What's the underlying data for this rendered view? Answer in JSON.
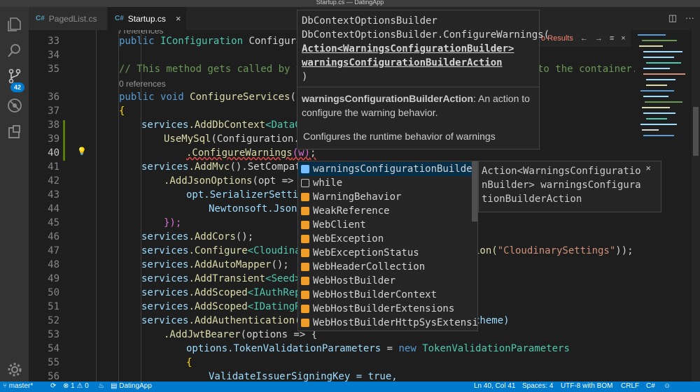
{
  "window": {
    "title": "Startup.cs — DatingApp"
  },
  "activity": {
    "scm_badge": "42"
  },
  "tabs": [
    {
      "icon": "C#",
      "label": "PagedList.cs"
    },
    {
      "icon": "C#",
      "label": "Startup.cs",
      "close": "×"
    }
  ],
  "line_numbers": [
    "33",
    "34",
    "35",
    "36",
    "37",
    "38",
    "39",
    "40",
    "41",
    "42",
    "43",
    "44",
    "45",
    "46",
    "47",
    "48",
    "49",
    "50",
    "51",
    "52",
    "53",
    "54",
    "55",
    "56"
  ],
  "codelens": {
    "refs_top": "/ references",
    "refs_35": "0 references"
  },
  "code": {
    "l33_a": "public ",
    "l33_b": "IConfiguration",
    "l33_c": " Configurati",
    "l35": "// This method gets called by th",
    "l35_tail": "to the container.",
    "l36_a": "public ",
    "l36_b": "void",
    "l36_c": " ConfigureServices",
    "l36_d": "(IS",
    "l37": "{",
    "l38_a": "services",
    "l38_b": ".AddDbContext",
    "l38_c": "<DataCo",
    "l39_a": "UseMySql",
    "l39_b": "(Configuration.G",
    "l40_a": ".ConfigureWarnings",
    "l40_b": "(w)",
    "l40_c": ";",
    "l41_a": "services",
    "l41_b": ".AddMvc",
    "l41_c": "().SetCompati",
    "l42_a": ".AddJsonOptions",
    "l42_b": "(opt => {",
    "l43": "opt.SerializerSettin",
    "l44": "Newtonsoft.Json.",
    "l45": "});",
    "l46_a": "services",
    "l46_b": ".AddCors",
    "l46_c": "();",
    "l47_a": "services",
    "l47_b": ".Configure",
    "l47_c": "<Cloudinar",
    "l47_tail_a": "ion(",
    "l47_tail_b": "\"CloudinarySettings\"",
    "l47_tail_c": "));",
    "l48_a": "services",
    "l48_b": ".AddAutoMapper",
    "l48_c": "();",
    "l49_a": "services",
    "l49_b": ".AddTransient",
    "l49_c": "<Seed>(",
    "l50_a": "services",
    "l50_b": ".AddScoped",
    "l50_c": "<IAuthRepo",
    "l51_a": "services",
    "l51_b": ".AddScoped",
    "l51_c": "<IDatingRe",
    "l52_a": "services",
    "l52_b": ".AddAuthentication",
    "l52_c": "(J",
    "l52_tail": "cheme)",
    "l53_a": ".AddJwtBearer",
    "l53_b": "(options => {",
    "l54_a": "options",
    "l54_b": ".TokenValidationParameters",
    "l54_c": " = ",
    "l54_d": "new",
    "l54_e": " TokenValidationParameters",
    "l55": "{",
    "l56": "ValidateIssuerSigningKey = true,"
  },
  "hover": {
    "type": "DbContextOptionsBuilder",
    "method": "DbContextOptionsBuilder.ConfigureWarnings(",
    "param_type": "Action<WarningsConfigurationBuilder>",
    "param_name": "warningsConfigurationBuilderAction",
    "close_paren": ")",
    "param_doc_name": "warningsConfigurationBuilderAction",
    "param_doc_text": ": An action to configure the warning behavior.",
    "summary": "Configures the runtime behavior of warnings"
  },
  "find_widget": {
    "status": "o Results",
    "prev": "←",
    "next": "→",
    "menu": "≡",
    "close": "×"
  },
  "suggestions": [
    {
      "icon": "variable-icon",
      "label": "warningsConfigurationBuilderA",
      "match": "w"
    },
    {
      "icon": "keyword-icon",
      "label": "while",
      "match": "w"
    },
    {
      "icon": "class-icon",
      "label": "WarningBehavior",
      "match": "W"
    },
    {
      "icon": "class-icon",
      "label": "WeakReference",
      "match": "W"
    },
    {
      "icon": "class-icon",
      "label": "WebClient",
      "match": "W"
    },
    {
      "icon": "class-icon",
      "label": "WebException",
      "match": "W"
    },
    {
      "icon": "class-icon",
      "label": "WebExceptionStatus",
      "match": "W"
    },
    {
      "icon": "class-icon",
      "label": "WebHeaderCollection",
      "match": "W"
    },
    {
      "icon": "class-icon",
      "label": "WebHostBuilder",
      "match": "W"
    },
    {
      "icon": "class-icon",
      "label": "WebHostBuilderContext",
      "match": "W"
    },
    {
      "icon": "class-icon",
      "label": "WebHostBuilderExtensions",
      "match": "W"
    },
    {
      "icon": "class-icon",
      "label": "WebHostBuilderHttpSysExtensi",
      "match": "W"
    }
  ],
  "details": {
    "text": "Action<WarningsConfigurationBuilder> warningsConfigurationBuilderAction",
    "close": "×"
  },
  "status": {
    "branch": "master*",
    "errors": "1",
    "warnings": "0",
    "project": "DatingApp",
    "position": "Ln 40, Col 41",
    "spaces": "Spaces: 4",
    "encoding": "UTF-8 with BOM",
    "eol": "CRLF",
    "language": "C#"
  },
  "colors": {
    "accent": "#007acc",
    "editor_bg": "#1e1e1e",
    "keyword": "#569cd6",
    "type": "#4ec9b0",
    "method": "#dcdcaa"
  }
}
